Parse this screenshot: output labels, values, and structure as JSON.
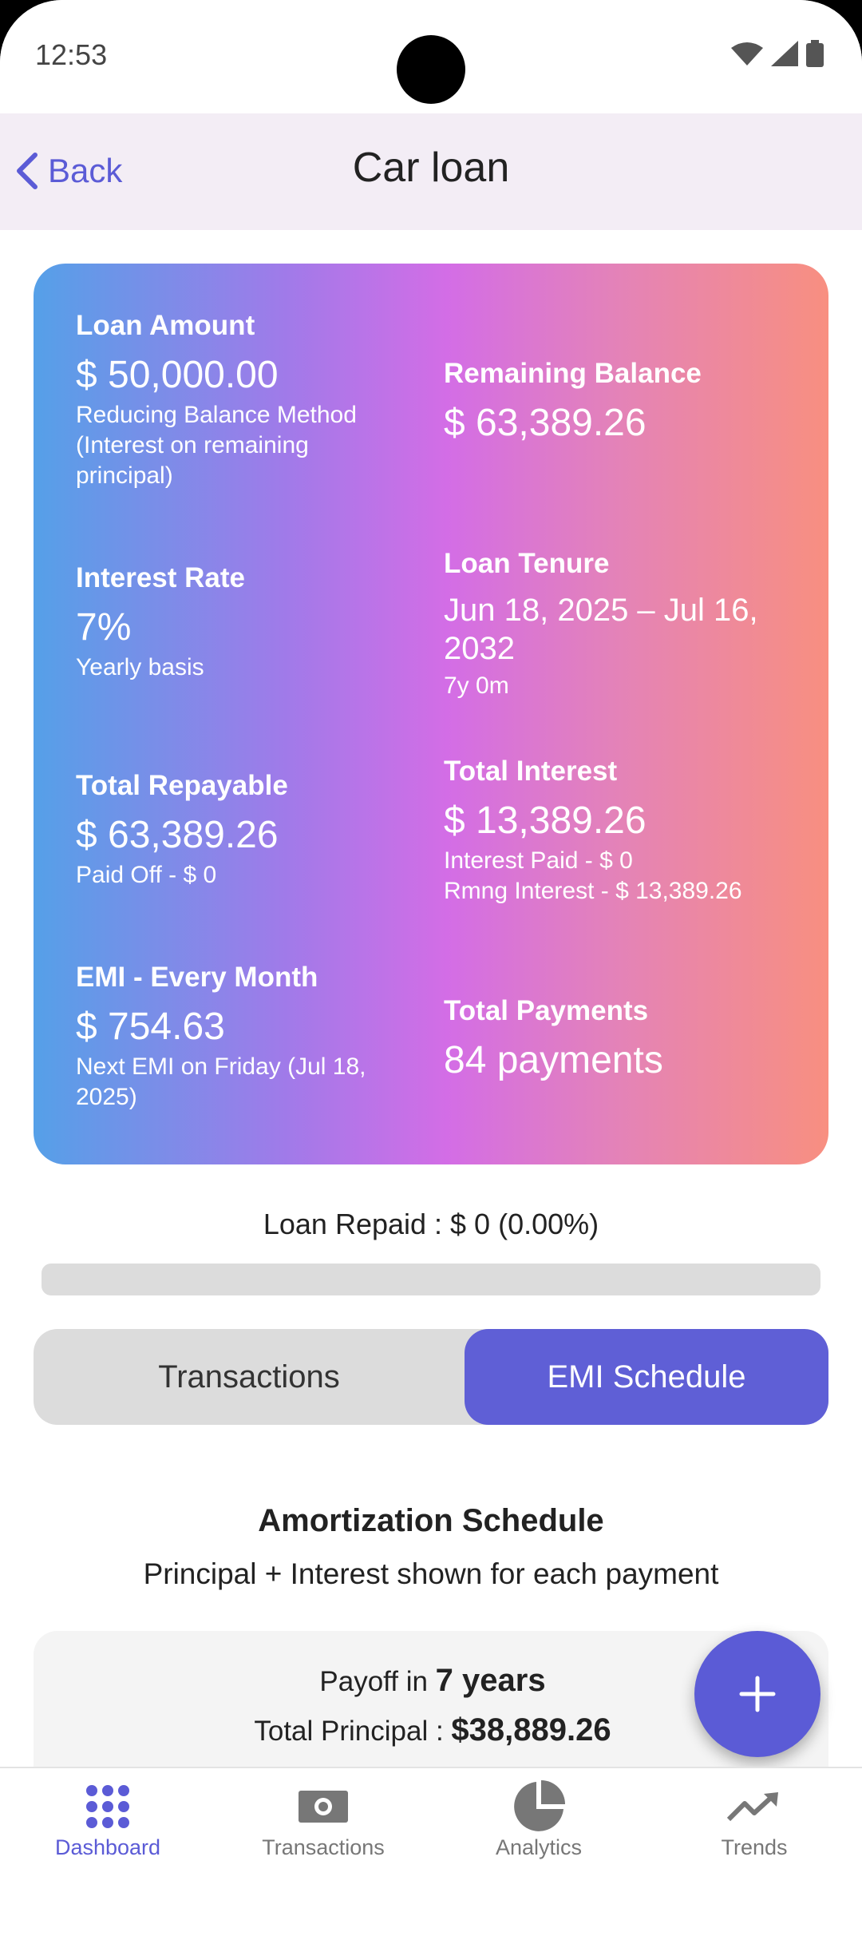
{
  "status_bar": {
    "time": "12:53"
  },
  "header": {
    "back_label": "Back",
    "title": "Car loan"
  },
  "summary": {
    "loan_amount": {
      "label": "Loan Amount",
      "value": "$ 50,000.00",
      "sub": "Reducing Balance Method (Interest on remaining principal)"
    },
    "remaining_balance": {
      "label": "Remaining Balance",
      "value": "$ 63,389.26"
    },
    "interest_rate": {
      "label": "Interest Rate",
      "value": "7%",
      "sub": "Yearly basis"
    },
    "loan_tenure": {
      "label": "Loan Tenure",
      "value": "Jun 18, 2025 – Jul 16, 2032",
      "sub": "7y 0m"
    },
    "total_repayable": {
      "label": "Total Repayable",
      "value": "$ 63,389.26",
      "sub": "Paid Off - $ 0"
    },
    "total_interest": {
      "label": "Total Interest",
      "value": "$ 13,389.26",
      "sub1": "Interest Paid - $ 0",
      "sub2": "Rmng Interest - $ 13,389.26"
    },
    "emi": {
      "label": "EMI - Every Month",
      "value": "$ 754.63",
      "sub": "Next EMI on Friday (Jul 18, 2025)"
    },
    "total_payments": {
      "label": "Total Payments",
      "value": "84 payments"
    }
  },
  "repaid": {
    "text": "Loan Repaid : $ 0 (0.00%)",
    "fraction": 0.0
  },
  "tabs": {
    "transactions": "Transactions",
    "emi_schedule": "EMI Schedule",
    "active": "EMI Schedule"
  },
  "schedule": {
    "title": "Amortization Schedule",
    "subtitle": "Principal + Interest shown for each payment",
    "payoff_prefix": "Payoff in ",
    "payoff_value": "7 years",
    "principal_prefix": "Total Principal :  ",
    "principal_value": "$38,889.26"
  },
  "fab": {
    "icon": "plus-icon"
  },
  "nav": {
    "items": [
      {
        "label": "Dashboard",
        "icon": "grid-dots-icon",
        "active": true
      },
      {
        "label": "Transactions",
        "icon": "cash-icon",
        "active": false
      },
      {
        "label": "Analytics",
        "icon": "pie-chart-icon",
        "active": false
      },
      {
        "label": "Trends",
        "icon": "trend-up-icon",
        "active": false
      }
    ]
  },
  "colors": {
    "accent": "#5b5bd6",
    "tab_active": "#5f5fd6",
    "track": "#dcdcdc"
  }
}
